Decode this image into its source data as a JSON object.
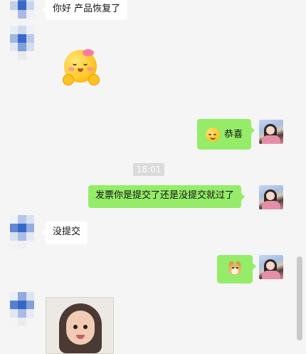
{
  "messages": [
    {
      "id": 1,
      "side": "left",
      "type": "text",
      "text": "你好  产品恢复了"
    },
    {
      "id": 2,
      "side": "left",
      "type": "sticker",
      "sticker": "smiling-blush-emoji-sticker"
    },
    {
      "id": 3,
      "side": "right",
      "type": "text",
      "emoji": "smiling-face-emoji",
      "text": "恭喜"
    },
    {
      "id": 4,
      "side": "center",
      "type": "timestamp",
      "text": "18:01"
    },
    {
      "id": 5,
      "side": "right",
      "type": "text",
      "text": "发票你是提交了还是没提交就过了"
    },
    {
      "id": 6,
      "side": "left",
      "type": "text",
      "text": "没提交"
    },
    {
      "id": 7,
      "side": "right",
      "type": "emoji",
      "emoji": "doge-emoji"
    },
    {
      "id": 8,
      "side": "left",
      "type": "image",
      "image": "child-photo"
    }
  ],
  "colors": {
    "background": "#f5f5f5",
    "bubble_left": "#ffffff",
    "bubble_right": "#95ec69",
    "timestamp_bg": "#dadada"
  },
  "icons": {
    "contact_avatar": "pixelated-avatar-icon",
    "self_avatar": "user-photo-avatar-icon"
  }
}
